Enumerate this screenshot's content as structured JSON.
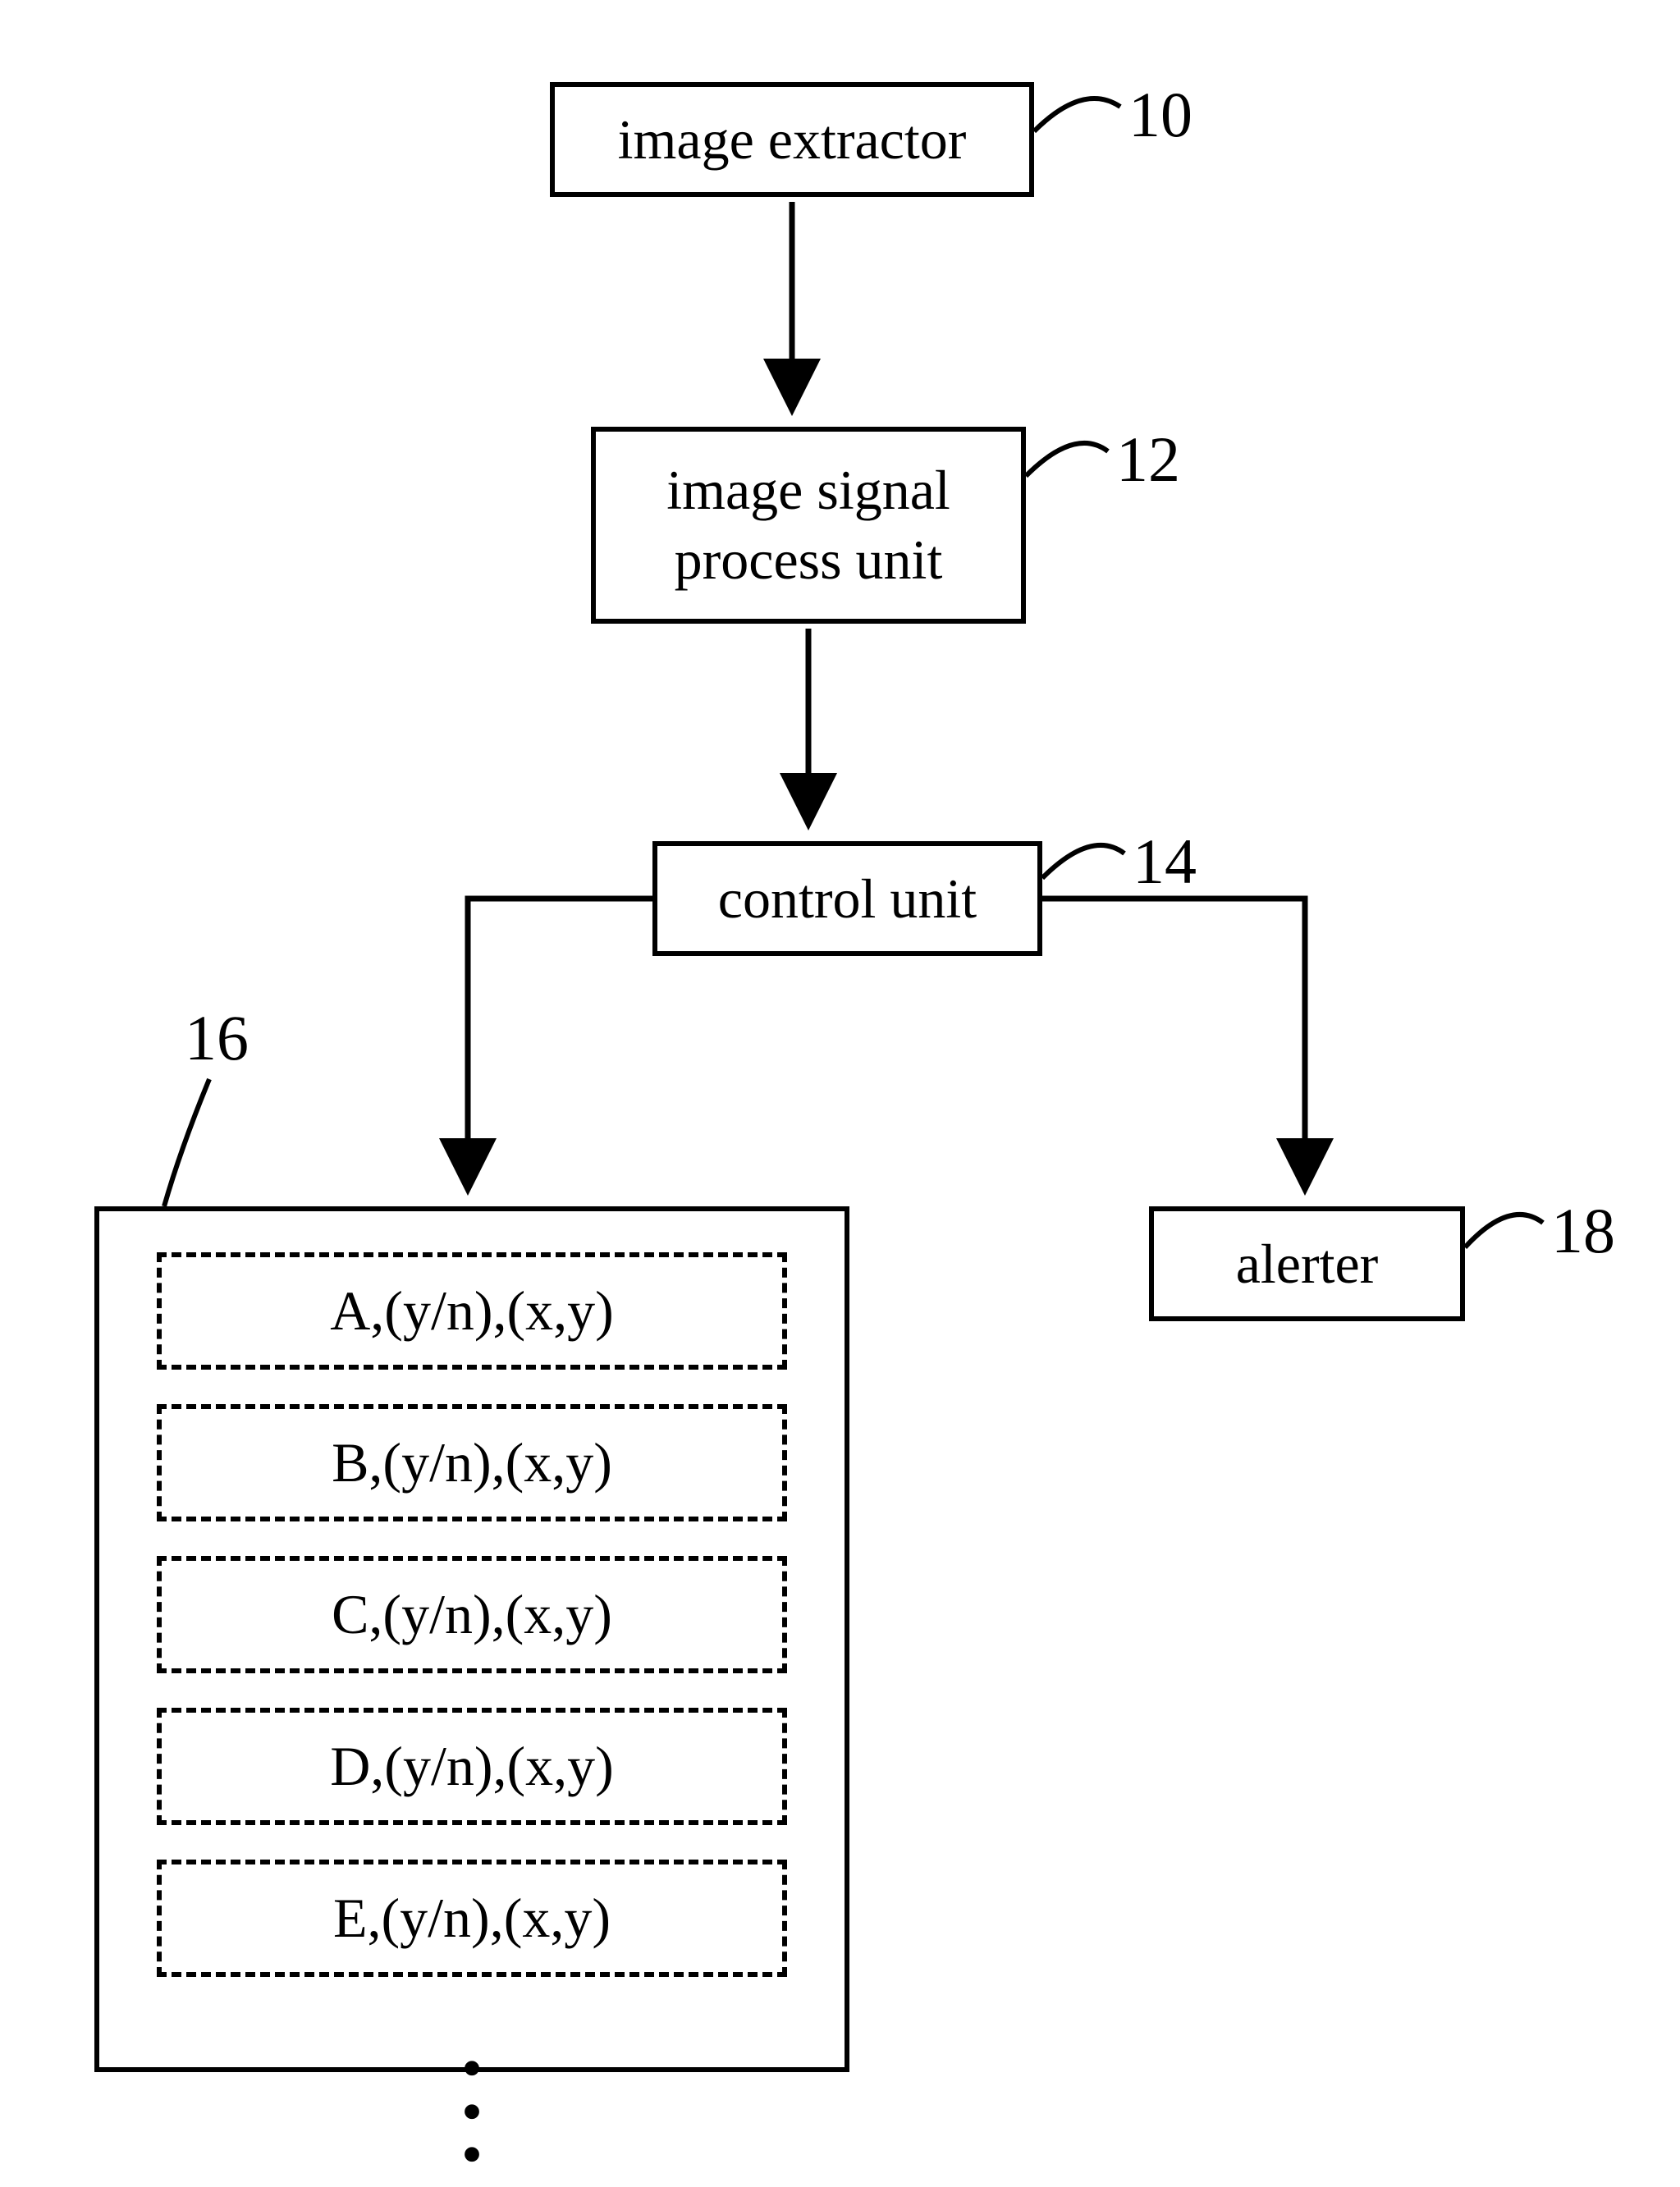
{
  "blocks": {
    "extractor": {
      "label": "image extractor",
      "ref": "10"
    },
    "isp": {
      "label": "image signal\nprocess unit",
      "ref": "12"
    },
    "control": {
      "label": "control unit",
      "ref": "14"
    },
    "alerter": {
      "label": "alerter",
      "ref": "18"
    },
    "storage": {
      "ref": "16"
    }
  },
  "storage_items": [
    "A,(y/n),(x,y)",
    "B,(y/n),(x,y)",
    "C,(y/n),(x,y)",
    "D,(y/n),(x,y)",
    "E,(y/n),(x,y)"
  ]
}
